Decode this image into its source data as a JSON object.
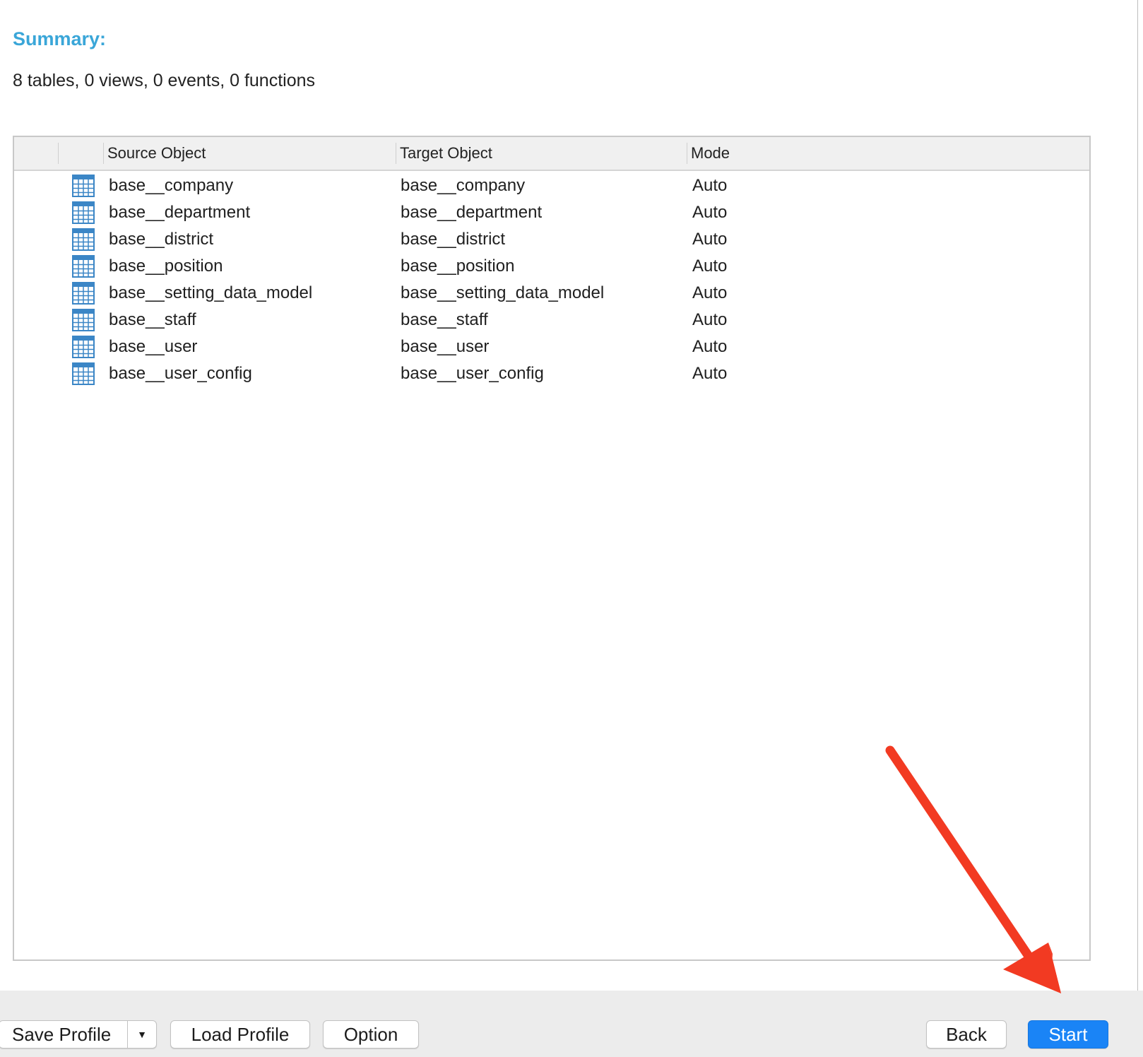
{
  "summary": {
    "title": "Summary:",
    "text": "8 tables, 0 views, 0 events, 0 functions"
  },
  "table": {
    "headers": {
      "source": "Source Object",
      "target": "Target Object",
      "mode": "Mode"
    },
    "rows": [
      {
        "source": "base__company",
        "target": "base__company",
        "mode": "Auto"
      },
      {
        "source": "base__department",
        "target": "base__department",
        "mode": "Auto"
      },
      {
        "source": "base__district",
        "target": "base__district",
        "mode": "Auto"
      },
      {
        "source": "base__position",
        "target": "base__position",
        "mode": "Auto"
      },
      {
        "source": "base__setting_data_model",
        "target": "base__setting_data_model",
        "mode": "Auto"
      },
      {
        "source": "base__staff",
        "target": "base__staff",
        "mode": "Auto"
      },
      {
        "source": "base__user",
        "target": "base__user",
        "mode": "Auto"
      },
      {
        "source": "base__user_config",
        "target": "base__user_config",
        "mode": "Auto"
      }
    ],
    "row_icon": "table-icon"
  },
  "footer": {
    "save_profile": "Save Profile",
    "load_profile": "Load Profile",
    "option": "Option",
    "back": "Back",
    "start": "Start"
  },
  "colors": {
    "accent": "#3aa6d8",
    "primary_button": "#1a84f6",
    "annotation_arrow": "#f23a22"
  }
}
